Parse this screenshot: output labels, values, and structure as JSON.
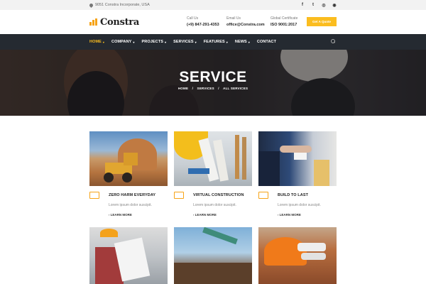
{
  "topbar": {
    "address": "9051 Constra Incorporate, USA",
    "social_icons": [
      "facebook-icon",
      "twitter-icon",
      "instagram-icon",
      "github-icon"
    ],
    "social_glyphs": [
      "f",
      "t",
      "◎",
      "◉"
    ]
  },
  "header": {
    "logo_text": "Constra",
    "contacts": [
      {
        "label": "Call Us",
        "value": "(+9) 847-291-4353"
      },
      {
        "label": "Email Us",
        "value": "office@Constra.com"
      },
      {
        "label": "Global Certificate",
        "value": "ISO 9001:2017"
      }
    ],
    "quote_button": "Get A Quote",
    "accent_color": "#fbbd1f"
  },
  "nav": {
    "items": [
      {
        "label": "HOME",
        "caret": "▾"
      },
      {
        "label": "COMPANY",
        "caret": "▾"
      },
      {
        "label": "PROJECTS",
        "caret": "▾"
      },
      {
        "label": "SERVICES",
        "caret": "▾"
      },
      {
        "label": "FEATURES",
        "caret": "▾"
      },
      {
        "label": "NEWS",
        "caret": "▾"
      },
      {
        "label": "CONTACT",
        "caret": ""
      }
    ],
    "active_index": 0,
    "background": "#252a31"
  },
  "hero": {
    "title": "SERVICE",
    "breadcrumb": [
      "HOME",
      "/",
      "SERVICES",
      "/",
      "ALL SERVICES"
    ]
  },
  "services": [
    {
      "title": "ZERO HARM EVERYDAY",
      "description": "Lorem ipsum dolor suscipit.",
      "link": "LEARN MORE",
      "icon": "safety-icon"
    },
    {
      "title": "VIRTUAL CONSTRUCTION",
      "description": "Lorem ipsum dolor suscipit.",
      "link": "LEARN MORE",
      "icon": "building-icon"
    },
    {
      "title": "BUILD TO LAST",
      "description": "Lorem ipsum dolor suscipit.",
      "link": "LEARN MORE",
      "icon": "handshake-icon"
    }
  ],
  "more_arrow": "›"
}
